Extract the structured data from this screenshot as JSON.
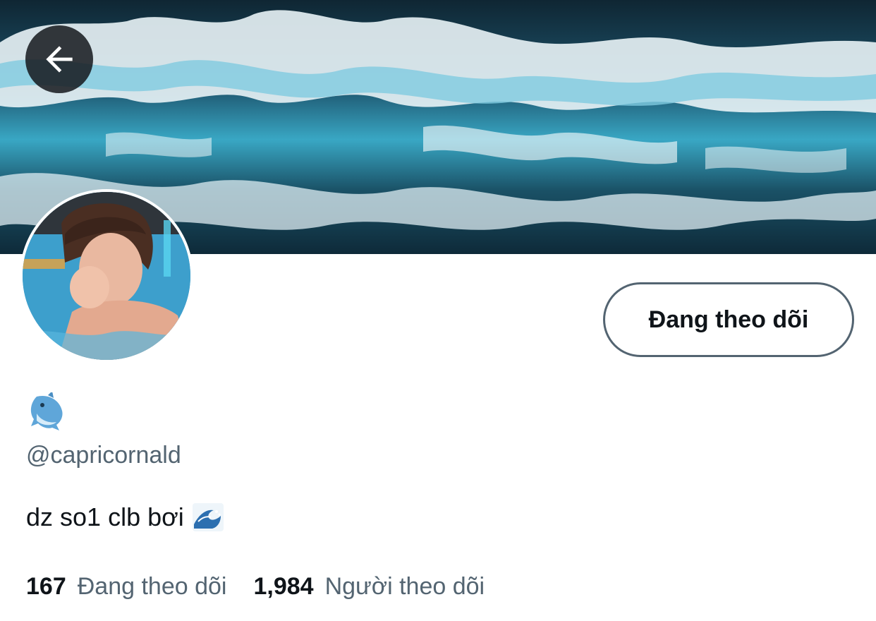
{
  "profile": {
    "handle": "@capricornald",
    "display_name_icon": "dolphin-emoji",
    "bio_text": "dz so1 clb bơi",
    "bio_icon": "water-wave-emoji",
    "follow_button_label": "Đang theo dõi",
    "banner_image": "ocean-wave-banner",
    "avatar_image": "person-in-pool-avatar"
  },
  "stats": {
    "following_count": "167",
    "following_label": "Đang theo dõi",
    "followers_count": "1,984",
    "followers_label": "Người theo dõi"
  },
  "colors": {
    "primary_text": "#0f1419",
    "secondary_text": "#536471",
    "button_border": "#536471",
    "back_button_bg": "#14181c"
  }
}
